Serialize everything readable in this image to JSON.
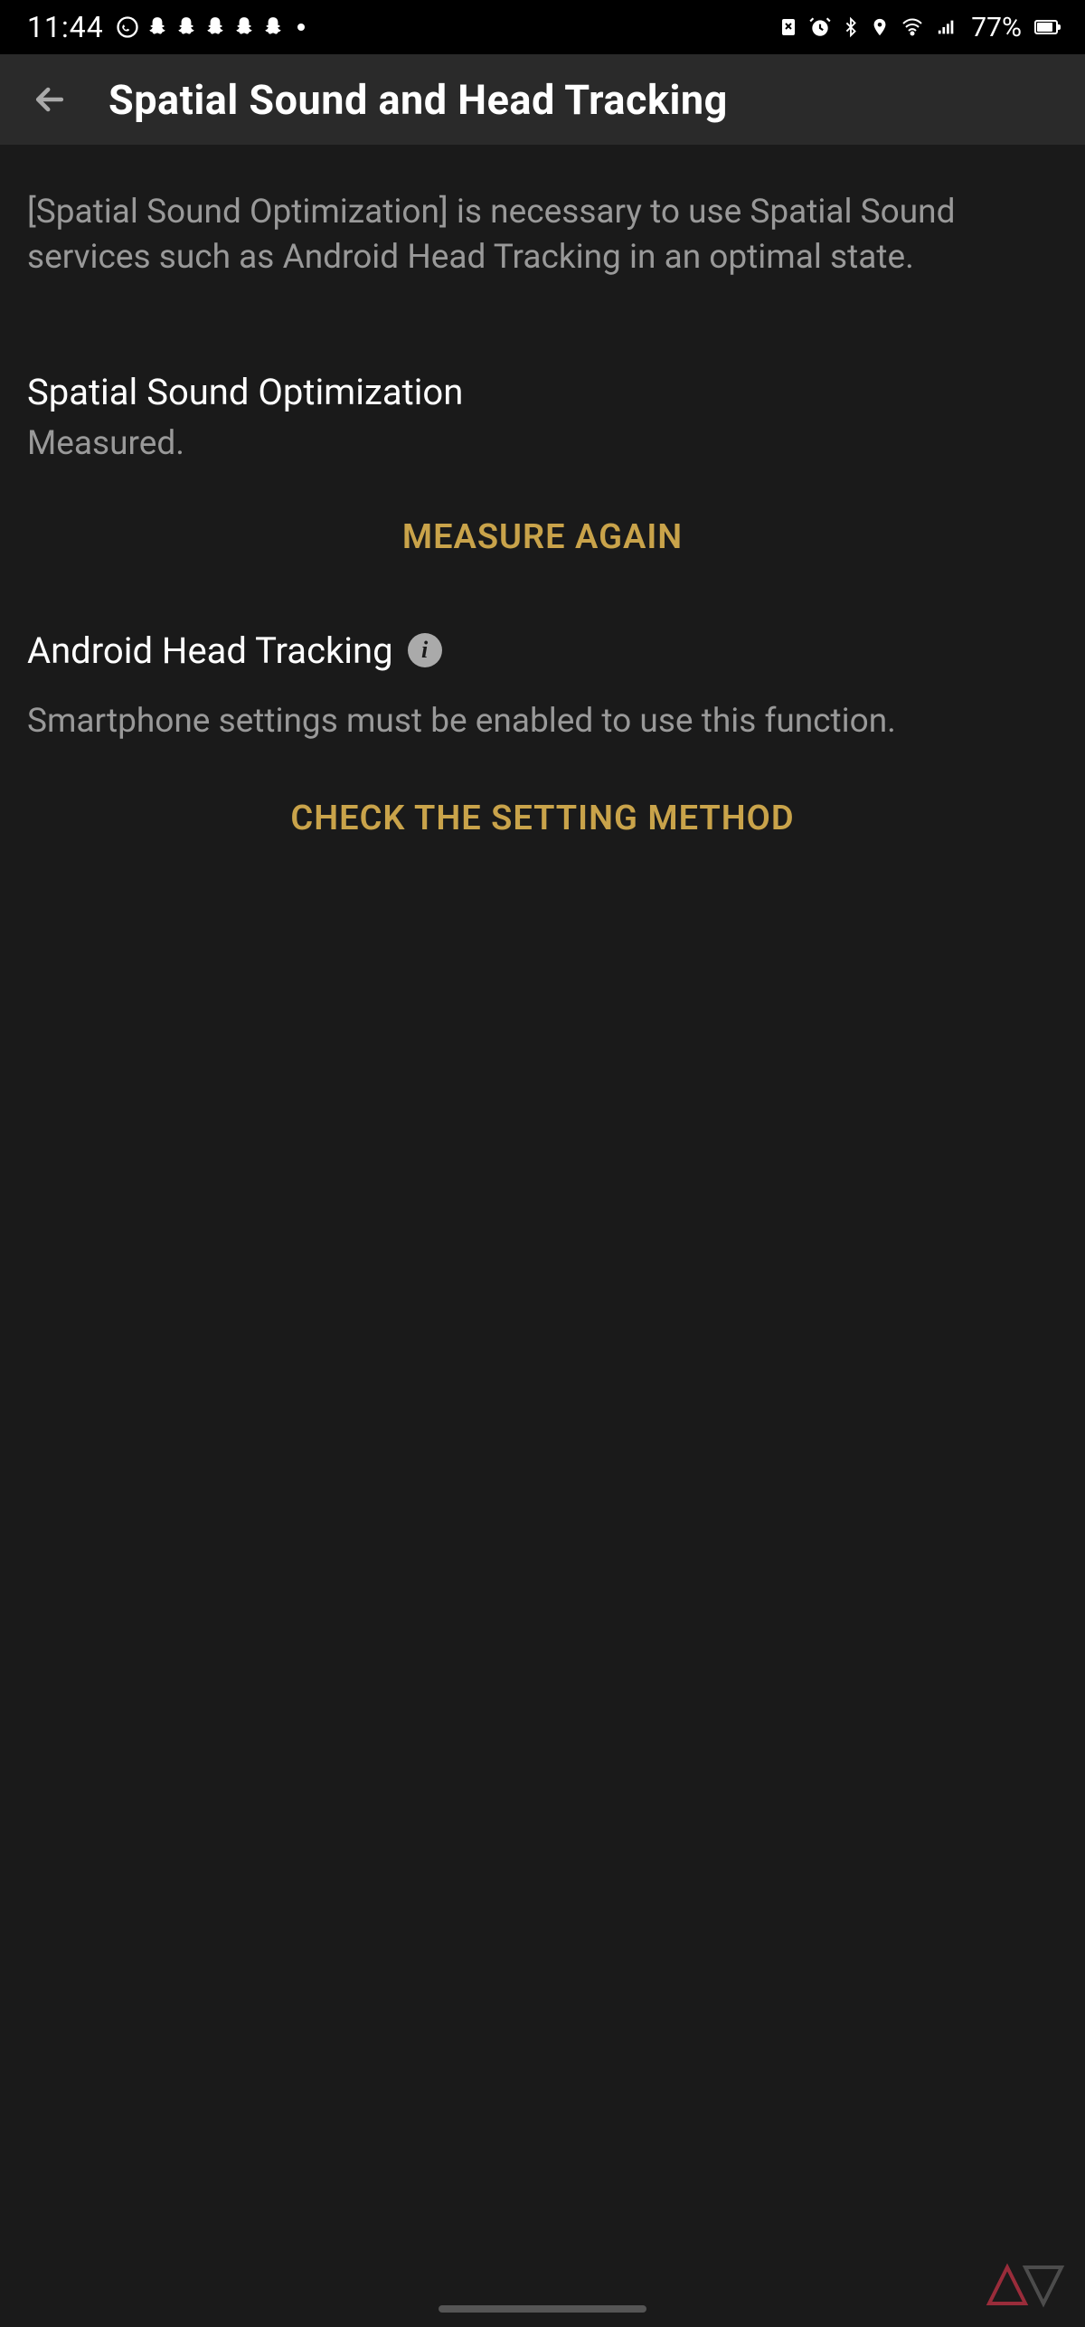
{
  "status_bar": {
    "time": "11:44",
    "battery_percent": "77%"
  },
  "header": {
    "title": "Spatial Sound and Head Tracking"
  },
  "intro": "[Spatial Sound Optimization] is necessary to use Spatial Sound services such as Android Head Tracking in an optimal state.",
  "section1": {
    "title": "Spatial Sound Optimization",
    "status": "Measured.",
    "action": "MEASURE AGAIN"
  },
  "section2": {
    "title": "Android Head Tracking",
    "desc": "Smartphone settings must be enabled to use this function.",
    "action": "CHECK THE SETTING METHOD"
  }
}
